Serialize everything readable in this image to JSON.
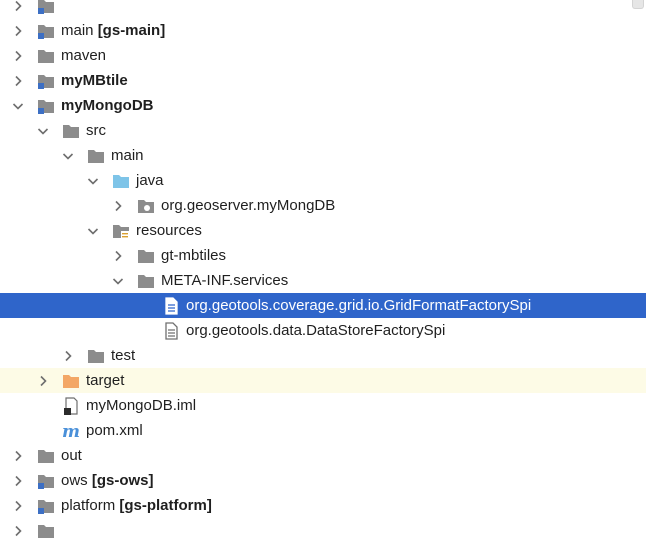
{
  "tree": {
    "rows": [
      {
        "label": "",
        "extra": "",
        "depth": 0,
        "arrow": "collapsed",
        "icon": "module-folder",
        "bold": false,
        "state": ""
      },
      {
        "label": "main",
        "extra": "[gs-main]",
        "depth": 0,
        "arrow": "collapsed",
        "icon": "module-folder",
        "bold": false,
        "state": ""
      },
      {
        "label": "maven",
        "extra": "",
        "depth": 0,
        "arrow": "collapsed",
        "icon": "folder",
        "bold": false,
        "state": ""
      },
      {
        "label": "myMBtile",
        "extra": "",
        "depth": 0,
        "arrow": "collapsed",
        "icon": "module-folder",
        "bold": true,
        "state": ""
      },
      {
        "label": "myMongoDB",
        "extra": "",
        "depth": 0,
        "arrow": "expanded",
        "icon": "module-folder",
        "bold": true,
        "state": ""
      },
      {
        "label": "src",
        "extra": "",
        "depth": 1,
        "arrow": "expanded",
        "icon": "folder",
        "bold": false,
        "state": ""
      },
      {
        "label": "main",
        "extra": "",
        "depth": 2,
        "arrow": "expanded",
        "icon": "folder",
        "bold": false,
        "state": ""
      },
      {
        "label": "java",
        "extra": "",
        "depth": 3,
        "arrow": "expanded",
        "icon": "source-folder",
        "bold": false,
        "state": ""
      },
      {
        "label": "org.geoserver.myMongDB",
        "extra": "",
        "depth": 4,
        "arrow": "collapsed",
        "icon": "package",
        "bold": false,
        "state": ""
      },
      {
        "label": "resources",
        "extra": "",
        "depth": 3,
        "arrow": "expanded",
        "icon": "resources-folder",
        "bold": false,
        "state": ""
      },
      {
        "label": "gt-mbtiles",
        "extra": "",
        "depth": 4,
        "arrow": "collapsed",
        "icon": "folder",
        "bold": false,
        "state": ""
      },
      {
        "label": "META-INF.services",
        "extra": "",
        "depth": 4,
        "arrow": "expanded",
        "icon": "folder",
        "bold": false,
        "state": ""
      },
      {
        "label": "org.geotools.coverage.grid.io.GridFormatFactorySpi",
        "extra": "",
        "depth": 5,
        "arrow": "none",
        "icon": "text-file",
        "bold": false,
        "state": "selected"
      },
      {
        "label": "org.geotools.data.DataStoreFactorySpi",
        "extra": "",
        "depth": 5,
        "arrow": "none",
        "icon": "text-file",
        "bold": false,
        "state": ""
      },
      {
        "label": "test",
        "extra": "",
        "depth": 2,
        "arrow": "collapsed",
        "icon": "folder",
        "bold": false,
        "state": ""
      },
      {
        "label": "target",
        "extra": "",
        "depth": 1,
        "arrow": "collapsed",
        "icon": "excluded-folder",
        "bold": false,
        "state": "excluded"
      },
      {
        "label": "myMongoDB.iml",
        "extra": "",
        "depth": 1,
        "arrow": "none",
        "icon": "iml-file",
        "bold": false,
        "state": ""
      },
      {
        "label": "pom.xml",
        "extra": "",
        "depth": 1,
        "arrow": "none",
        "icon": "maven-file",
        "bold": false,
        "state": ""
      },
      {
        "label": "out",
        "extra": "",
        "depth": 0,
        "arrow": "collapsed",
        "icon": "folder",
        "bold": false,
        "state": ""
      },
      {
        "label": "ows",
        "extra": "[gs-ows]",
        "depth": 0,
        "arrow": "collapsed",
        "icon": "module-folder",
        "bold": false,
        "state": ""
      },
      {
        "label": "platform",
        "extra": "[gs-platform]",
        "depth": 0,
        "arrow": "collapsed",
        "icon": "module-folder",
        "bold": false,
        "state": ""
      },
      {
        "label": "",
        "extra": "",
        "depth": 0,
        "arrow": "collapsed",
        "icon": "folder",
        "bold": false,
        "state": ""
      }
    ]
  },
  "colors": {
    "folder": "#8c8c8c",
    "source_folder": "#7ec4e8",
    "excluded_folder": "#f3a766",
    "module_dot": "#3c6fc4",
    "selection": "#2f65ca",
    "excluded_row": "#fdfbe6",
    "arrow": "#6e6e6e",
    "maven_m": "#4a90d9",
    "resources_lines": "#d9a030"
  }
}
